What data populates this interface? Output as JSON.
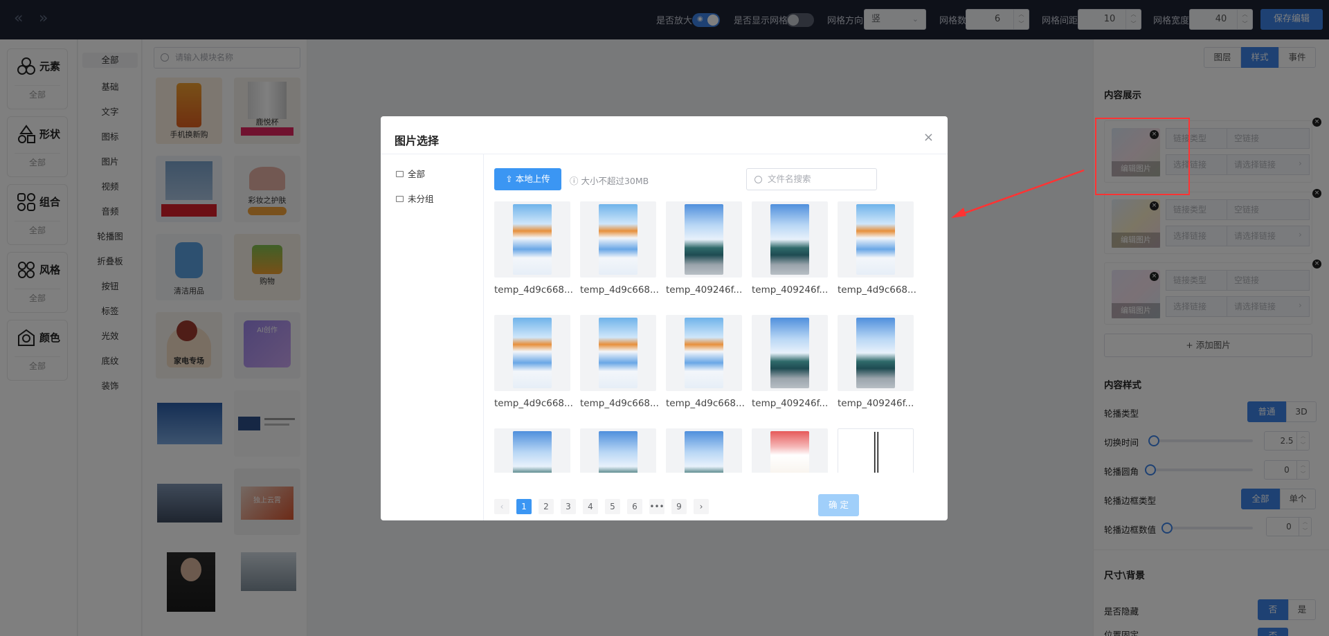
{
  "topbar": {
    "enlarge_label": "是否放大",
    "show_grid_label": "是否显示网格",
    "grid_direction_label": "网格方向",
    "grid_direction_value": "竖",
    "grid_count_label": "网格数",
    "grid_count_value": "6",
    "grid_gap_label": "网格间距",
    "grid_gap_value": "10",
    "grid_width_label": "网格宽度",
    "grid_width_value": "40",
    "save_label": "保存编辑",
    "enlarge_on": true,
    "show_grid_on": false
  },
  "categories": [
    {
      "name": "元素",
      "sub": "全部"
    },
    {
      "name": "形状",
      "sub": "全部"
    },
    {
      "name": "组合",
      "sub": "全部"
    },
    {
      "name": "风格",
      "sub": "全部"
    },
    {
      "name": "颜色",
      "sub": "全部"
    }
  ],
  "subcategories": [
    "全部",
    "基础",
    "文字",
    "图标",
    "图片",
    "视频",
    "音频",
    "轮播图",
    "折叠板",
    "按钮",
    "标签",
    "光效",
    "底纹",
    "装饰"
  ],
  "gallery": {
    "search_placeholder": "请输入模块名称",
    "thumbs": [
      {
        "caption": "手机换新购"
      },
      {
        "caption": "鹿悦杯"
      },
      {
        "caption": ""
      },
      {
        "caption": "彩妆之护肤"
      },
      {
        "caption": "清洁用品"
      },
      {
        "caption": "购物"
      },
      {
        "caption": "家电专场"
      },
      {
        "caption": "AI创作"
      },
      {
        "caption": ""
      },
      {
        "caption": ""
      },
      {
        "caption": ""
      },
      {
        "caption": "独上云霄"
      },
      {
        "caption": ""
      },
      {
        "caption": ""
      }
    ]
  },
  "right_panel": {
    "tabs": [
      {
        "label": "图层"
      },
      {
        "label": "样式"
      },
      {
        "label": "事件"
      }
    ],
    "active_tab": 1,
    "content_display_title": "内容展示",
    "images": [
      {
        "edit": "编辑图片",
        "link_type_btn": "链接类型",
        "link_type_val": "空链接",
        "select_link_btn": "选择链接",
        "select_link_val": "请选择链接"
      },
      {
        "edit": "编辑图片",
        "link_type_btn": "链接类型",
        "link_type_val": "空链接",
        "select_link_btn": "选择链接",
        "select_link_val": "请选择链接"
      },
      {
        "edit": "编辑图片",
        "link_type_btn": "链接类型",
        "link_type_val": "空链接",
        "select_link_btn": "选择链接",
        "select_link_val": "请选择链接"
      }
    ],
    "add_image_label": "添加图片",
    "content_style_title": "内容样式",
    "carousel_type_label": "轮播类型",
    "carousel_type_options": [
      "普通",
      "3D"
    ],
    "switch_time_label": "切换时间",
    "switch_time_value": "2.5",
    "corner_label": "轮播圆角",
    "corner_value": "0",
    "border_type_label": "轮播边框类型",
    "border_type_options": [
      "全部",
      "单个"
    ],
    "border_value_label": "轮播边框数值",
    "border_value": "0",
    "size_bg_title": "尺寸\\背景",
    "hidden_label": "是否隐藏",
    "hidden_options": [
      "否",
      "是"
    ],
    "pos_fixed_label": "位置固定",
    "pos_fixed_options": [
      "否"
    ]
  },
  "modal": {
    "title": "图片选择",
    "folders": [
      {
        "label": "全部"
      },
      {
        "label": "未分组"
      }
    ],
    "upload_label": "本地上传",
    "size_tip": "大小不超过30MB",
    "search_placeholder": "文件名搜索",
    "images": [
      {
        "name": "temp_4d9c668...",
        "kind": "shop"
      },
      {
        "name": "temp_4d9c668...",
        "kind": "shop"
      },
      {
        "name": "temp_409246f...",
        "kind": "car"
      },
      {
        "name": "temp_409246f...",
        "kind": "car"
      },
      {
        "name": "temp_4d9c668...",
        "kind": "shop"
      },
      {
        "name": "temp_4d9c668...",
        "kind": "shop"
      },
      {
        "name": "temp_4d9c668...",
        "kind": "shop"
      },
      {
        "name": "temp_4d9c668...",
        "kind": "shop"
      },
      {
        "name": "temp_409246f...",
        "kind": "car"
      },
      {
        "name": "temp_409246f...",
        "kind": "car"
      },
      {
        "name": "",
        "kind": "car"
      },
      {
        "name": "",
        "kind": "car"
      },
      {
        "name": "",
        "kind": "car"
      },
      {
        "name": "",
        "kind": "red"
      },
      {
        "name": "",
        "kind": "line"
      }
    ],
    "pages": [
      "1",
      "2",
      "3",
      "4",
      "5",
      "6",
      "•••",
      "9"
    ],
    "current_page": "1",
    "confirm_label": "确 定"
  },
  "colors": {
    "accent": "#3c82e6",
    "upload": "#3b96f3",
    "confirm_disabled": "#a0cffa",
    "highlight": "#ff3333",
    "topbar": "#1c2233"
  }
}
